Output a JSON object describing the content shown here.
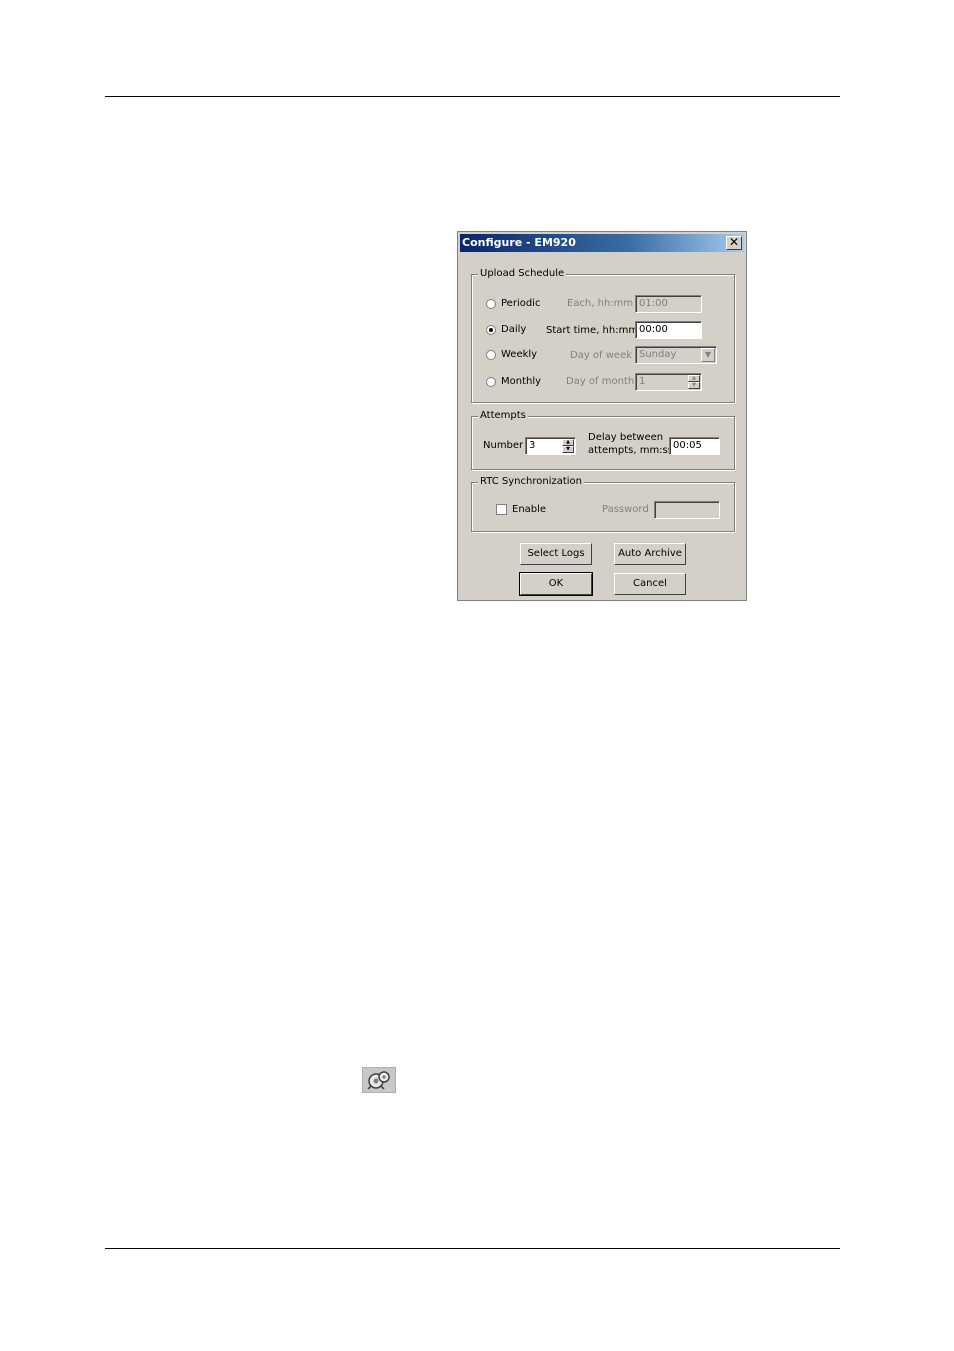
{
  "dialog": {
    "title": "Configure - EM920",
    "close_glyph": "✕",
    "upload_schedule": {
      "legend": "Upload Schedule",
      "options": [
        {
          "label": "Periodic",
          "field_label": "Each, hh:mm",
          "value": "01:00",
          "selected": false,
          "enabled": false
        },
        {
          "label": "Daily",
          "field_label": "Start time, hh:mm",
          "value": "00:00",
          "selected": true,
          "enabled": true
        },
        {
          "label": "Weekly",
          "field_label": "Day of week",
          "value": "Sunday",
          "selected": false,
          "enabled": false
        },
        {
          "label": "Monthly",
          "field_label": "Day of month",
          "value": "1",
          "selected": false,
          "enabled": false
        }
      ]
    },
    "attempts": {
      "legend": "Attempts",
      "number_label": "Number",
      "number_value": "3",
      "delay_label_line1": "Delay between",
      "delay_label_line2": "attempts, mm:ss",
      "delay_value": "00:05"
    },
    "rtc": {
      "legend": "RTC Synchronization",
      "enable_label": "Enable",
      "enable_checked": false,
      "password_label": "Password",
      "password_value": ""
    },
    "buttons": {
      "select_logs": "Select Logs",
      "auto_archive": "Auto Archive",
      "ok": "OK",
      "cancel": "Cancel"
    }
  },
  "toolbar_icon": {
    "icon": "configure-gear-icon"
  }
}
